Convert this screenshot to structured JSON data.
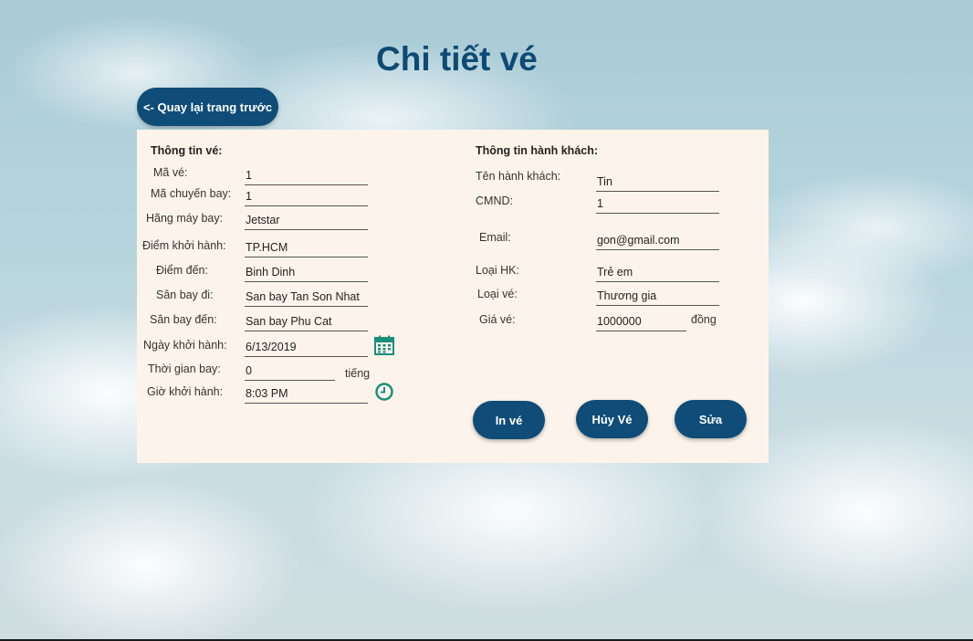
{
  "page": {
    "title": "Chi tiết vé",
    "back_label": "<- Quay lại trang trước"
  },
  "ticket": {
    "section_title": "Thông tin vé:",
    "fields": [
      {
        "label": "Mã vé:",
        "value": "1"
      },
      {
        "label": "Mã chuyến bay:",
        "value": "1"
      },
      {
        "label": "Hãng máy bay:",
        "value": "Jetstar"
      },
      {
        "label": "Điểm khởi hành:",
        "value": "TP.HCM"
      },
      {
        "label": "Điểm đến:",
        "value": "Binh Dinh"
      },
      {
        "label": "Sân bay đi:",
        "value": "San bay Tan Son Nhat"
      },
      {
        "label": "Sân bay đến:",
        "value": "San bay Phu Cat"
      },
      {
        "label": "Ngày khởi hành:",
        "value": "6/13/2019"
      },
      {
        "label": "Thời gian bay:",
        "value": "0",
        "unit": "tiếng"
      },
      {
        "label": "Giờ khởi hành:",
        "value": "8:03 PM"
      }
    ]
  },
  "passenger": {
    "section_title": "Thông tin hành khách:",
    "fields": [
      {
        "label": "Tên hành khách:",
        "value": "Tin"
      },
      {
        "label": "CMND:",
        "value": "1"
      },
      {
        "label": "Email:",
        "value": "gon@gmail.com"
      },
      {
        "label": "Loại HK:",
        "value": "Trẻ em"
      },
      {
        "label": "Loại vé:",
        "value": "Thương gia"
      },
      {
        "label": "Giá vé:",
        "value": "1000000",
        "unit": "đồng"
      }
    ]
  },
  "actions": {
    "print_label": "In vé",
    "cancel_label": "Hủy Vé",
    "edit_label": "Sửa"
  },
  "icons": {
    "calendar": "calendar-icon",
    "clock": "clock-icon"
  },
  "colors": {
    "primary": "#0f4c78",
    "title": "#0e4a73",
    "panel": "#fcf4ea",
    "icon": "#1a8f7a"
  }
}
